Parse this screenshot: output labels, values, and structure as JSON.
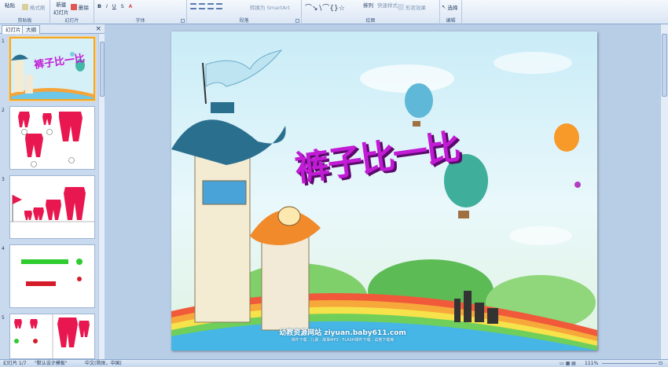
{
  "ribbon": {
    "clipboard": {
      "paste": "粘贴",
      "format_painter": "格式刷",
      "label": "剪贴板"
    },
    "slides": {
      "new_slide": "新建",
      "new_slide_2": "幻灯片",
      "delete": "删除",
      "label": "幻灯片"
    },
    "font": {
      "label": "字体"
    },
    "paragraph": {
      "smartart": "转换为 SmartArt",
      "label": "段落"
    },
    "drawing": {
      "arrange": "排列",
      "quick_styles": "快速样式",
      "shape_effects": "形状效果",
      "label": "绘图"
    },
    "editing": {
      "select": "选择",
      "label": "编辑"
    }
  },
  "panel": {
    "tabs": [
      "幻灯片",
      "大纲"
    ],
    "close": "×",
    "slides": [
      {
        "num": "1"
      },
      {
        "num": "2"
      },
      {
        "num": "3"
      },
      {
        "num": "4"
      },
      {
        "num": "5"
      }
    ]
  },
  "slide": {
    "title": "裤子比一比",
    "site": "幼教资源网站 ziyuan.baby611.com",
    "site_sub": "课件下载 · 儿歌 · 故事MP3 · FLASH课件下载 · 试卷下载等"
  },
  "statusbar": {
    "slide_info": "幻灯片 1/7",
    "theme": "\"默认设计模板\"",
    "language": "中文(简体，中国)",
    "zoom": "111%"
  },
  "colors": {
    "title": "#c21bd6",
    "pants": "#e8174f",
    "selected_border": "#f5a623",
    "green": "#2ecc2e"
  }
}
